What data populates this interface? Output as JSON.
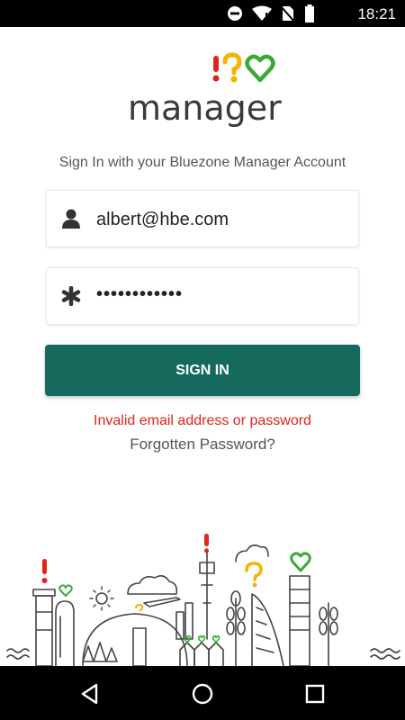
{
  "status_bar": {
    "time": "18:21",
    "icons": [
      "do-not-disturb-icon",
      "wifi-icon",
      "no-sim-icon",
      "battery-icon"
    ]
  },
  "logo": {
    "word": "manager",
    "colors": {
      "red": "#e2231a",
      "yellow": "#f5b400",
      "green": "#3aaa35"
    }
  },
  "subtitle": "Sign In with your Bluezone Manager Account",
  "email_field": {
    "value": "albert@hbe.com",
    "icon": "user-icon"
  },
  "password_field": {
    "value": "••••••••••••",
    "icon": "asterisk-icon"
  },
  "signin_button": {
    "label": "SIGN IN",
    "color": "#156a5d"
  },
  "error_message": "Invalid email address or password",
  "forgot_link": "Forgotten Password?",
  "nav_bar": {
    "icons": [
      "back-icon",
      "home-icon",
      "recents-icon"
    ]
  }
}
